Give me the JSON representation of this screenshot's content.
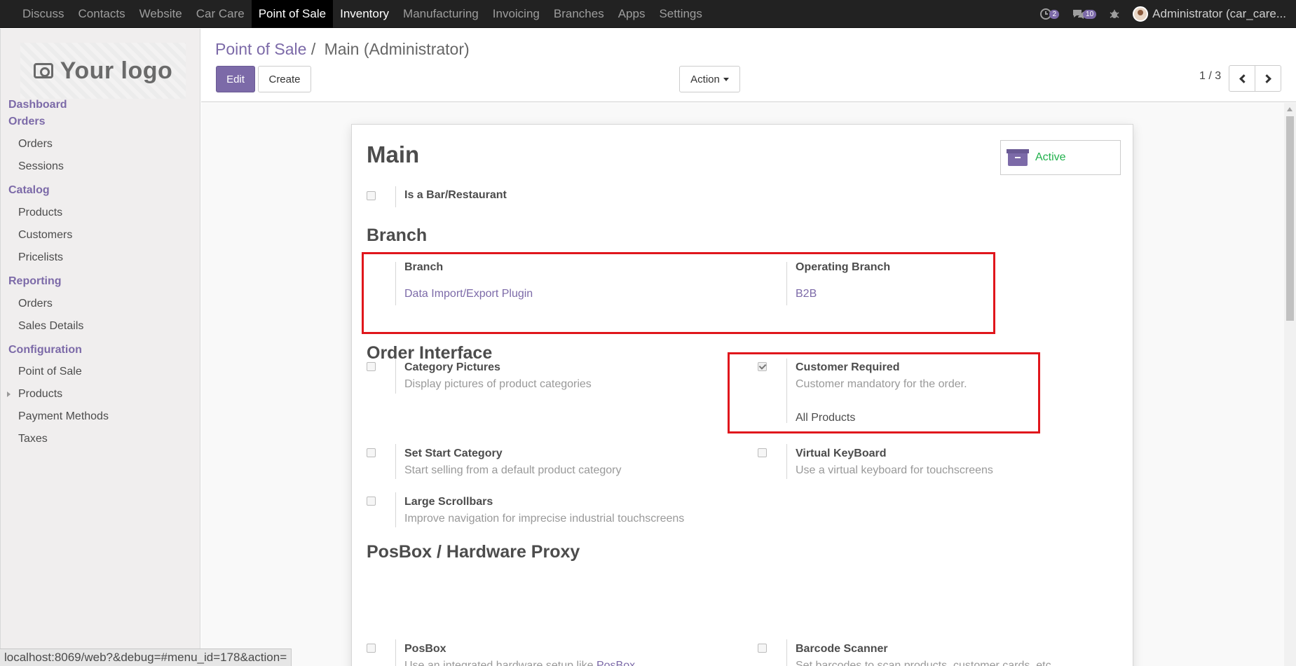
{
  "topbar": {
    "menu": [
      "Discuss",
      "Contacts",
      "Website",
      "Car Care",
      "Point of Sale",
      "Inventory",
      "Manufacturing",
      "Invoicing",
      "Branches",
      "Apps",
      "Settings"
    ],
    "active_menu": "Point of Sale",
    "activity_count": "2",
    "messages_count": "10",
    "user": "Administrator (car_care..."
  },
  "sidebar": {
    "logo_text": "Your logo",
    "dashboard": "Dashboard",
    "orders_section": "Orders",
    "orders_items": [
      "Orders",
      "Sessions"
    ],
    "catalog_section": "Catalog",
    "catalog_items": [
      "Products",
      "Customers",
      "Pricelists"
    ],
    "reporting_section": "Reporting",
    "reporting_items": [
      "Orders",
      "Sales Details"
    ],
    "config_section": "Configuration",
    "config_items": [
      "Point of Sale",
      "Products",
      "Payment Methods",
      "Taxes"
    ]
  },
  "control_panel": {
    "breadcrumb_parent": "Point of Sale",
    "breadcrumb_sep": "/",
    "breadcrumb_current": "Main (Administrator)",
    "edit_label": "Edit",
    "create_label": "Create",
    "action_label": "Action",
    "pager": "1 / 3"
  },
  "form": {
    "title": "Main",
    "active_label": "Active",
    "is_bar_label": "Is a Bar/Restaurant",
    "is_bar_checked": false,
    "branch_heading": "Branch",
    "branch_label": "Branch",
    "branch_value": "Data Import/Export Plugin",
    "operating_branch_label": "Operating Branch",
    "operating_branch_value": "B2B",
    "order_interface_heading": "Order Interface",
    "category_pictures_label": "Category Pictures",
    "category_pictures_desc": "Display pictures of product categories",
    "category_pictures_checked": false,
    "customer_required_label": "Customer Required",
    "customer_required_desc": "Customer mandatory for the order.",
    "customer_required_value": "All Products",
    "customer_required_checked": true,
    "set_start_category_label": "Set Start Category",
    "set_start_category_desc": "Start selling from a default product category",
    "set_start_category_checked": false,
    "virtual_keyboard_label": "Virtual KeyBoard",
    "virtual_keyboard_desc": "Use a virtual keyboard for touchscreens",
    "virtual_keyboard_checked": false,
    "large_scrollbars_label": "Large Scrollbars",
    "large_scrollbars_desc": "Improve navigation for imprecise industrial touchscreens",
    "large_scrollbars_checked": false,
    "posbox_heading": "PosBox / Hardware Proxy",
    "posbox_label": "PosBox",
    "posbox_desc_prefix": "Use an integrated hardware setup like",
    "posbox_desc_link": "PosBox",
    "barcode_scanner_label": "Barcode Scanner",
    "barcode_scanner_desc": "Set barcodes to scan products, customer cards, etc."
  },
  "status_url": "localhost:8069/web?&debug=#menu_id=178&action=",
  "colors": {
    "brand": "#7c6aa8",
    "highlight_box": "#e0161c",
    "active_green": "#21b14c",
    "navbar": "#222222"
  }
}
